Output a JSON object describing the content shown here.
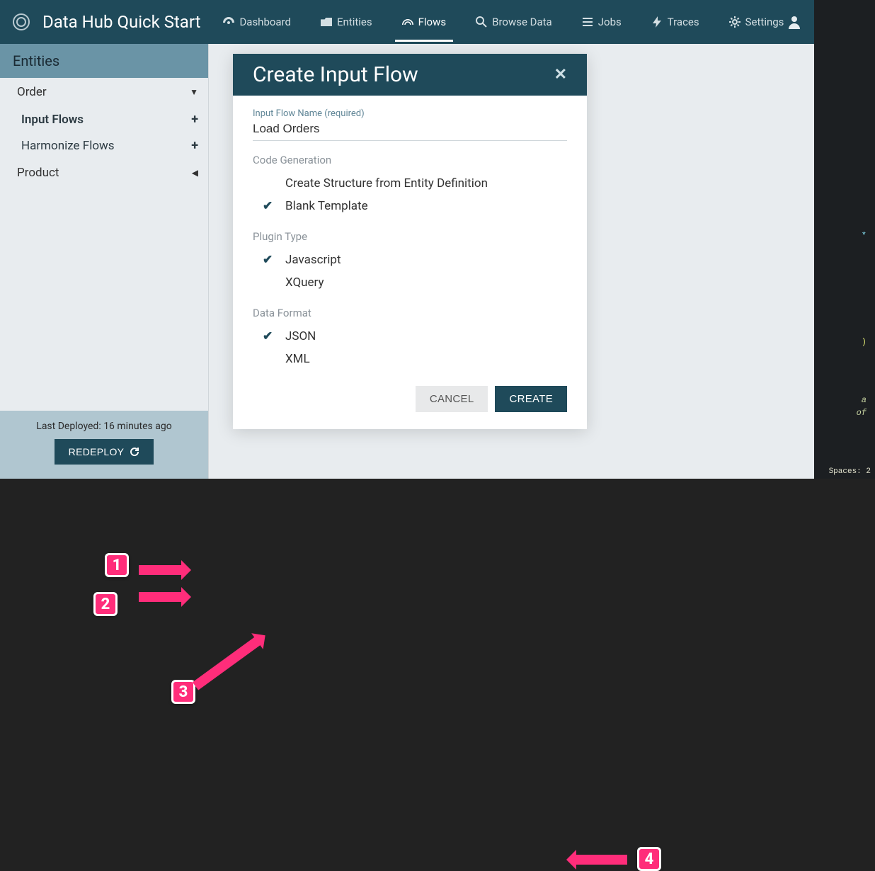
{
  "header": {
    "app_title": "Data Hub Quick Start",
    "nav": [
      {
        "label": "Dashboard",
        "icon": "dashboard-icon"
      },
      {
        "label": "Entities",
        "icon": "folder-icon"
      },
      {
        "label": "Flows",
        "icon": "flows-icon",
        "active": true
      },
      {
        "label": "Browse Data",
        "icon": "search-icon"
      },
      {
        "label": "Jobs",
        "icon": "jobs-icon"
      },
      {
        "label": "Traces",
        "icon": "traces-icon"
      },
      {
        "label": "Settings",
        "icon": "gear-icon"
      }
    ]
  },
  "sidebar": {
    "header": "Entities",
    "items": [
      {
        "name": "Order",
        "expanded": true,
        "children": [
          {
            "label": "Input Flows"
          },
          {
            "label": "Harmonize Flows"
          }
        ]
      },
      {
        "name": "Product",
        "expanded": false
      }
    ],
    "footer": {
      "deploy_text": "Last Deployed: 16 minutes ago",
      "redeploy_label": "REDEPLOY"
    }
  },
  "modal": {
    "title": "Create Input Flow",
    "field_label": "Input Flow Name (required)",
    "field_value": "Load Orders",
    "sections": [
      {
        "label": "Code Generation",
        "options": [
          {
            "label": "Create Structure from Entity Definition",
            "selected": false
          },
          {
            "label": "Blank Template",
            "selected": true
          }
        ]
      },
      {
        "label": "Plugin Type",
        "options": [
          {
            "label": "Javascript",
            "selected": true
          },
          {
            "label": "XQuery",
            "selected": false
          }
        ]
      },
      {
        "label": "Data Format",
        "options": [
          {
            "label": "JSON",
            "selected": true
          },
          {
            "label": "XML",
            "selected": false
          }
        ]
      }
    ],
    "cancel_label": "CANCEL",
    "create_label": "CREATE"
  },
  "annotations": {
    "n1": "1",
    "n2": "2",
    "n3": "3",
    "n4": "4"
  },
  "editor_hint": {
    "status": "Spaces: 2",
    "star": "*",
    "paren": ")",
    "word_a": "a",
    "word_of": "of"
  }
}
